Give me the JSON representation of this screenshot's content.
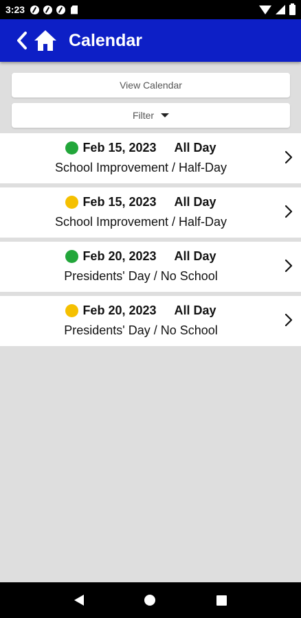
{
  "status_bar": {
    "time": "3:23",
    "icons": [
      "notification-icon",
      "notification-icon",
      "notification-icon",
      "sd-card-icon",
      "wifi-icon",
      "signal-icon",
      "battery-icon"
    ]
  },
  "app_bar": {
    "title": "Calendar",
    "color": "#0d1fc6",
    "icons": [
      "back-icon",
      "home-icon"
    ]
  },
  "controls": {
    "view_calendar_label": "View Calendar",
    "filter_label": "Filter"
  },
  "events": [
    {
      "date": "Feb 15, 2023",
      "time": "All Day",
      "title": "School Improvement / Half-Day",
      "dot_color": "#22a63a"
    },
    {
      "date": "Feb 15, 2023",
      "time": "All Day",
      "title": "School Improvement / Half-Day",
      "dot_color": "#f5c000"
    },
    {
      "date": "Feb 20, 2023",
      "time": "All Day",
      "title": "Presidents' Day / No School",
      "dot_color": "#22a63a"
    },
    {
      "date": "Feb 20, 2023",
      "time": "All Day",
      "title": "Presidents' Day / No School",
      "dot_color": "#f5c000"
    }
  ],
  "nav_bar": {
    "icons": [
      "nav-back-icon",
      "nav-home-icon",
      "nav-recents-icon"
    ]
  }
}
